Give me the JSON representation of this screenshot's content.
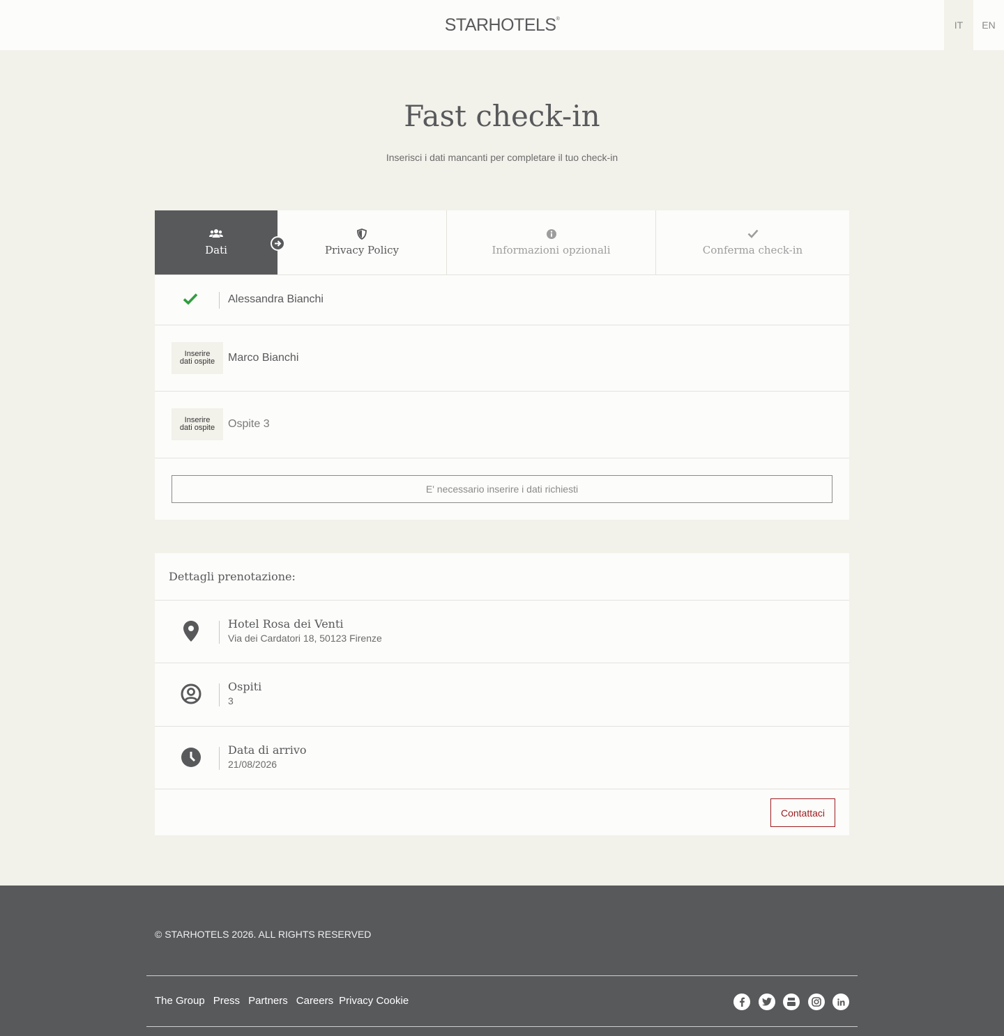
{
  "header": {
    "logo_text": "STARHOTELS",
    "languages": [
      "IT",
      "EN"
    ],
    "active_language": "IT"
  },
  "page": {
    "title": "Fast check-in",
    "subtitle": "Inserisci i dati mancanti per completare il tuo check-in"
  },
  "steps": [
    {
      "label": "Dati",
      "icon": "users-icon",
      "state": "active"
    },
    {
      "label": "Privacy Policy",
      "icon": "shield-icon",
      "state": "next"
    },
    {
      "label": "Informazioni opzionali",
      "icon": "info-icon",
      "state": "disabled"
    },
    {
      "label": "Conferma check-in",
      "icon": "check-icon",
      "state": "disabled"
    }
  ],
  "guests": {
    "items": [
      {
        "name": "Alessandra Bianchi",
        "status": "complete"
      },
      {
        "name": "Marco Bianchi",
        "status": "missing",
        "badge_line1": "Inserire",
        "badge_line2": "dati ospite"
      },
      {
        "name": "Ospite 3",
        "status": "missing",
        "badge_line1": "Inserire",
        "badge_line2": "dati ospite"
      }
    ],
    "submit_label": "E' necessario inserire i dati richiesti"
  },
  "booking": {
    "title": "Dettagli prenotazione:",
    "hotel_name": "Hotel Rosa dei Venti",
    "hotel_address": "Via dei Cardatori 18, 50123 Firenze",
    "guests_label": "Ospiti",
    "guests_count": "3",
    "arrival_label": "Data di arrivo",
    "arrival_date": "21/08/2026",
    "contact_label": "Contattaci"
  },
  "footer": {
    "copyright": "© STARHOTELS 2026. ALL RIGHTS RESERVED",
    "links": [
      "The Group",
      "Press",
      "Partners",
      "Careers",
      "Privacy Cookie"
    ],
    "social": [
      "facebook-icon",
      "twitter-icon",
      "youtube-icon",
      "instagram-icon",
      "linkedin-icon"
    ]
  },
  "colors": {
    "background": "#f2f1ea",
    "panel": "#fcfcfa",
    "primary_gray": "#58595b",
    "success_green": "#2e9e3e",
    "accent_red": "#9b1b1f"
  }
}
